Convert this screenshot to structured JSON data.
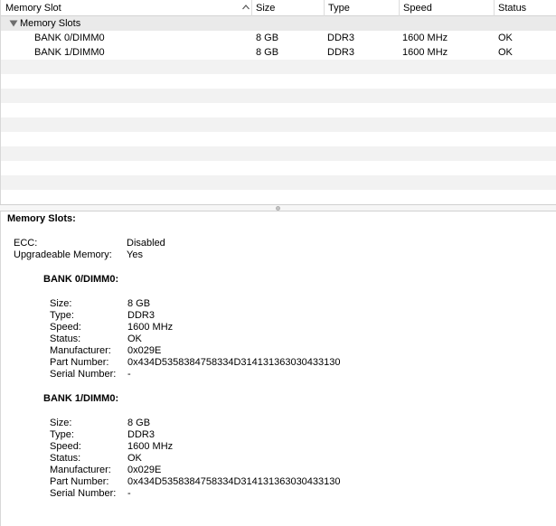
{
  "table": {
    "columns": [
      "Memory Slot",
      "Size",
      "Type",
      "Speed",
      "Status"
    ],
    "group_label": "Memory Slots",
    "rows": [
      {
        "slot": "BANK 0/DIMM0",
        "size": "8 GB",
        "type": "DDR3",
        "speed": "1600 MHz",
        "status": "OK"
      },
      {
        "slot": "BANK 1/DIMM0",
        "size": "8 GB",
        "type": "DDR3",
        "speed": "1600 MHz",
        "status": "OK"
      }
    ]
  },
  "detail": {
    "heading": "Memory Slots:",
    "ecc_label": "ECC:",
    "ecc_value": "Disabled",
    "upgradeable_label": "Upgradeable Memory:",
    "upgradeable_value": "Yes",
    "banks": [
      {
        "title": "BANK 0/DIMM0:",
        "fields": [
          {
            "label": "Size:",
            "value": "8 GB"
          },
          {
            "label": "Type:",
            "value": "DDR3"
          },
          {
            "label": "Speed:",
            "value": "1600 MHz"
          },
          {
            "label": "Status:",
            "value": "OK"
          },
          {
            "label": "Manufacturer:",
            "value": "0x029E"
          },
          {
            "label": "Part Number:",
            "value": "0x434D5358384758334D314131363030433130"
          },
          {
            "label": "Serial Number:",
            "value": "-"
          }
        ]
      },
      {
        "title": "BANK 1/DIMM0:",
        "fields": [
          {
            "label": "Size:",
            "value": "8 GB"
          },
          {
            "label": "Type:",
            "value": "DDR3"
          },
          {
            "label": "Speed:",
            "value": "1600 MHz"
          },
          {
            "label": "Status:",
            "value": "OK"
          },
          {
            "label": "Manufacturer:",
            "value": "0x029E"
          },
          {
            "label": "Part Number:",
            "value": "0x434D5358384758334D314131363030433130"
          },
          {
            "label": "Serial Number:",
            "value": "-"
          }
        ]
      }
    ]
  },
  "icons": {
    "sort": "sort-ascending-icon",
    "disclosure": "disclosure-triangle-expanded-icon",
    "splitter": "splitter-grip-icon"
  }
}
